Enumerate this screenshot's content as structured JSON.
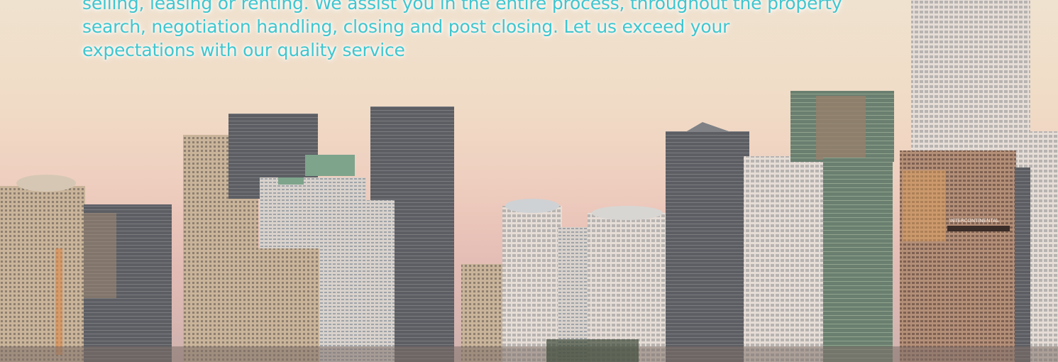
{
  "hero": {
    "intro_lines": [
      "selling, leasing or renting. We assist you in the entire process, throughout the property",
      "search, negotiation handling, closing and post closing. Let us exceed your",
      "expectations with our quality service"
    ],
    "text_color": "#3fc6cf",
    "sky_colors": [
      "#efe2cf",
      "#efd0c0",
      "#dfb9b3"
    ],
    "building_signs": [
      "INTERCONTINENTAL"
    ]
  }
}
